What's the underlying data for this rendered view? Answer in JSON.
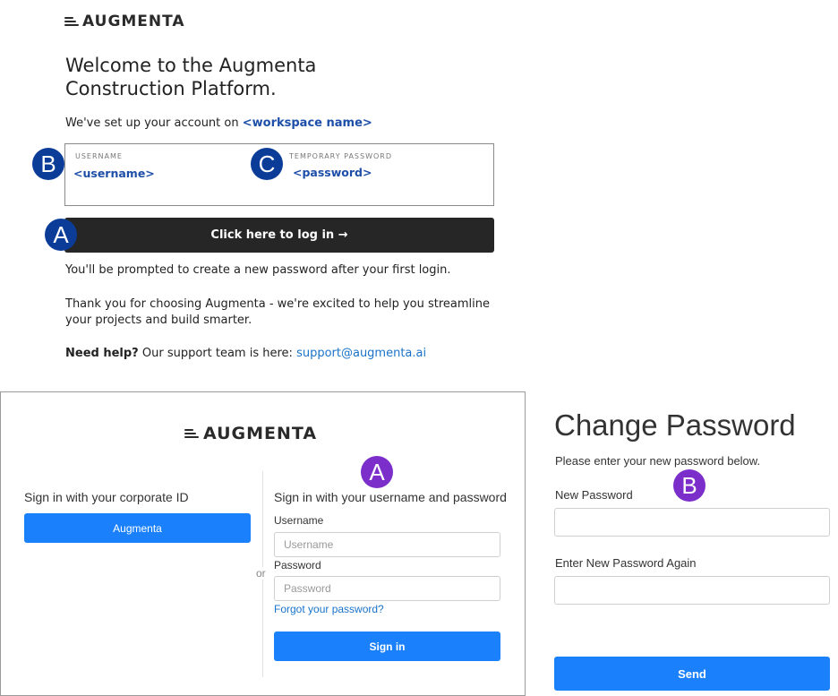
{
  "email": {
    "logo_text": "AUGMENTA",
    "title": "Welcome to the Augmenta Construction Platform.",
    "setup_text": "We've set up your account on",
    "workspace_name": "<workspace name>",
    "credentials": {
      "username_label": "USERNAME",
      "username_value": "<username>",
      "password_label": "TEMPORARY PASSWORD",
      "password_value": "<password>"
    },
    "login_button": "Click here to log in →",
    "prompt_text": "You'll be prompted to create a new password after your first login.",
    "thanks_text": "Thank you for choosing Augmenta - we're excited to help you streamline your projects and build smarter.",
    "help_bold": "Need help?",
    "help_text": "Our support team is here:",
    "support_email": "support@augmenta.ai",
    "badges": {
      "a": "A",
      "b": "B",
      "c": "C"
    }
  },
  "signin": {
    "logo_text": "AUGMENTA",
    "corporate_heading": "Sign in with your corporate ID",
    "corporate_button": "Augmenta",
    "or_text": "or",
    "userpass_heading": "Sign in with your username and password",
    "username_label": "Username",
    "username_placeholder": "Username",
    "password_label": "Password",
    "password_placeholder": "Password",
    "forgot_link": "Forgot your password?",
    "signin_button": "Sign in",
    "badge": "A"
  },
  "change_password": {
    "title": "Change Password",
    "subtitle": "Please enter your new password below.",
    "new_label": "New Password",
    "again_label": "Enter New Password Again",
    "send_button": "Send",
    "badge": "B"
  },
  "colors": {
    "badge_email": "#0b3d98",
    "badge_screens": "#7b2ec9",
    "primary_button": "#1a80fb",
    "login_bar": "#262626",
    "link": "#1a73c9"
  }
}
